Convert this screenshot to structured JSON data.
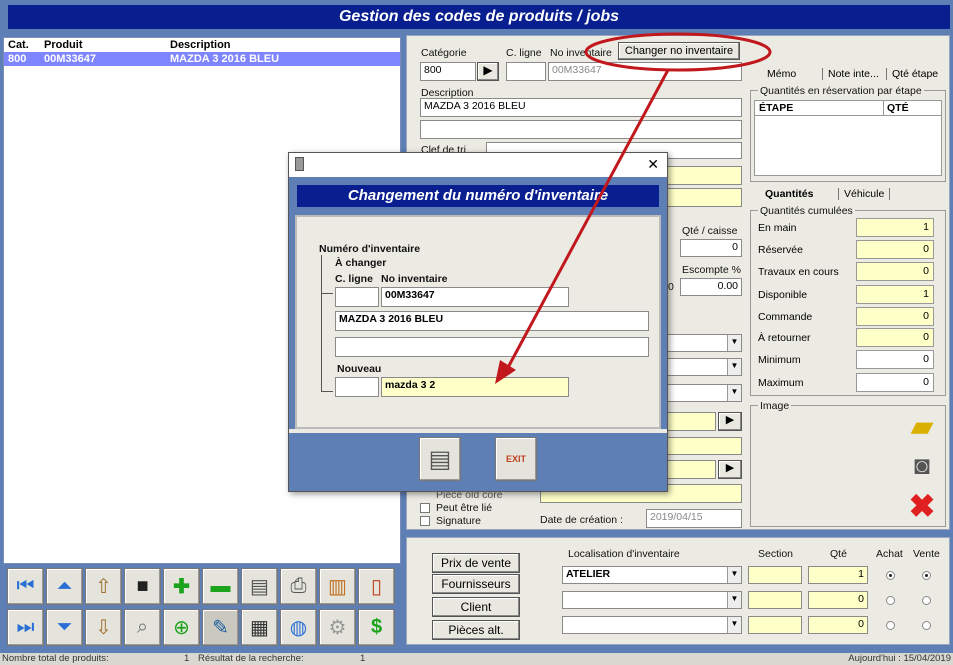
{
  "window_title": "Gestion des codes de produits / jobs",
  "list": {
    "headers": [
      "Cat.",
      "Produit",
      "Description"
    ],
    "rows": [
      [
        "800",
        "00M33647",
        "MAZDA 3 2016 BLEU"
      ]
    ]
  },
  "form": {
    "categorie_label": "Catégorie",
    "categorie_value": "800",
    "c_ligne_label": "C. ligne",
    "no_inventaire_label": "No inventaire",
    "no_inventaire_value": "00M33647",
    "changer_button": "Changer no inventaire",
    "description_label": "Description",
    "description_value": "MAZDA 3 2016 BLEU",
    "clef_label": "Clef de tri",
    "qte_caisse_label": "Qté / caisse",
    "qte_caisse_value": "0",
    "escompte_label": "Escompte %",
    "escompte_value": "0.00",
    "zero_value": "0",
    "piece_old_core": "Pièce old core",
    "peut_etre_lie": "Peut être lié",
    "signature": "Signature",
    "date_creation_label": "Date de création :",
    "date_creation_value": "2019/04/15"
  },
  "tabs_top": [
    "Mémo",
    "Note inte...",
    "Qté étape"
  ],
  "reservation": {
    "legend": "Quantités en réservation par étape",
    "col_etape": "ÉTAPE",
    "col_qte": "QTÉ"
  },
  "tabs_qty": [
    "Quantités",
    "Véhicule"
  ],
  "quantities": {
    "legend": "Quantités cumulées",
    "rows": [
      {
        "label": "En main",
        "value": "1"
      },
      {
        "label": "Réservée",
        "value": "0"
      },
      {
        "label": "Travaux en cours",
        "value": "0"
      },
      {
        "label": "Disponible",
        "value": "1"
      },
      {
        "label": "Commande",
        "value": "0"
      },
      {
        "label": "À retourner",
        "value": "0"
      },
      {
        "label": "Minimum",
        "value": "0"
      },
      {
        "label": "Maximum",
        "value": "0"
      }
    ]
  },
  "image_label": "Image",
  "side_buttons": [
    "Prix de vente",
    "Fournisseurs",
    "Client",
    "Pièces alt."
  ],
  "inventory_loc": {
    "col_localisation": "Localisation d'inventaire",
    "col_section": "Section",
    "col_qte": "Qté",
    "col_achat": "Achat",
    "col_vente": "Vente",
    "rows": [
      {
        "loc": "ATELIER",
        "qte": "1"
      },
      {
        "loc": "",
        "qte": "0"
      },
      {
        "loc": "",
        "qte": "0"
      }
    ]
  },
  "dialog": {
    "title": "Changement du numéro d'inventaire",
    "numero_label": "Numéro d'inventaire",
    "a_changer": "À changer",
    "c_ligne": "C. ligne",
    "no_inventaire": "No inventaire",
    "old_value": "00M33647",
    "old_desc": "MAZDA 3 2016 BLEU",
    "nouveau": "Nouveau",
    "new_value": "mazda 3 2",
    "close_glyph": "✕",
    "exit_label": "EXIT"
  },
  "status": {
    "total_label": "Nombre total de produits:",
    "total_value": "1",
    "result_label": "Résultat de la recherche:",
    "result_value": "1",
    "today": "Aujourd'hui : 15/04/2019"
  },
  "colors": {
    "title_bg": "#0a1f8f",
    "yellow": "#ffffc8",
    "highlight_row": "#7f85ff",
    "annotation_red": "#c0181d"
  }
}
